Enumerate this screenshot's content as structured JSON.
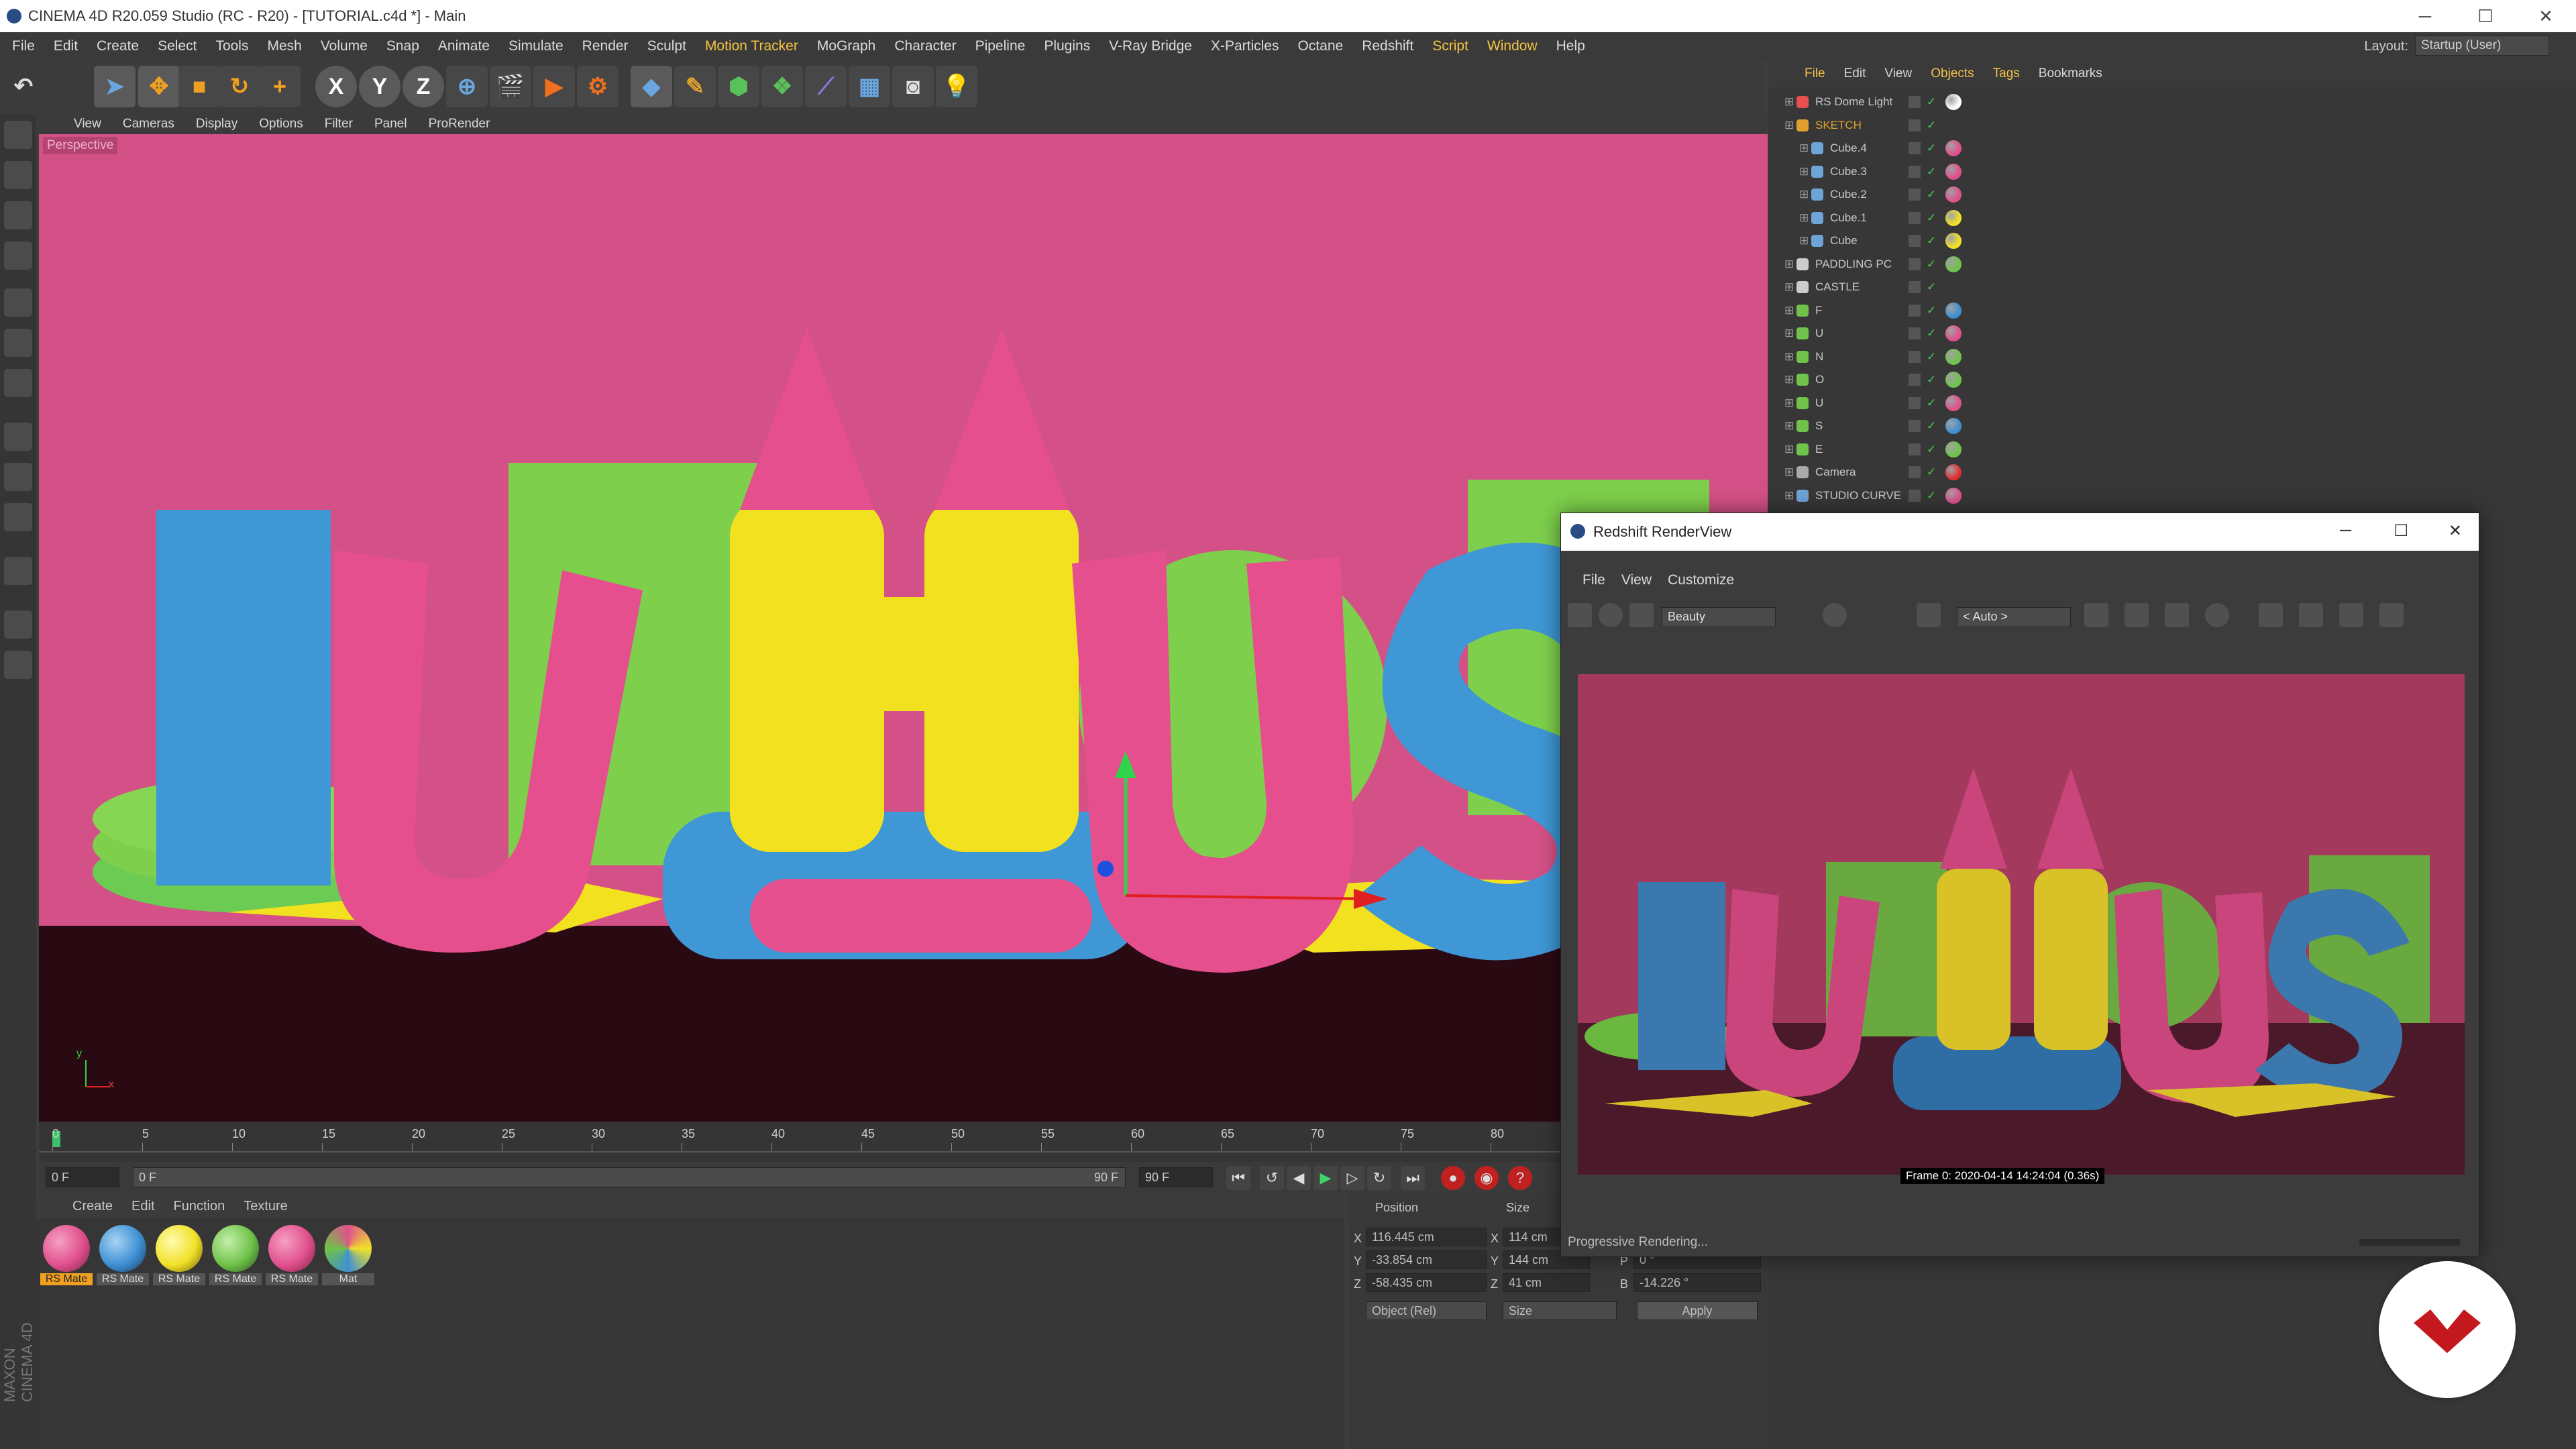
{
  "window": {
    "title": "CINEMA 4D R20.059 Studio (RC - R20) - [TUTORIAL.c4d *] - Main",
    "min_symbol": "─",
    "max_symbol": "☐",
    "close_symbol": "✕"
  },
  "menubar": {
    "items": [
      "File",
      "Edit",
      "Create",
      "Select",
      "Tools",
      "Mesh",
      "Volume",
      "Snap",
      "Animate",
      "Simulate",
      "Render",
      "Sculpt",
      "Motion Tracker",
      "MoGraph",
      "Character",
      "Pipeline",
      "Plugins",
      "V-Ray Bridge",
      "X-Particles",
      "Octane",
      "Redshift",
      "Script",
      "Window",
      "Help"
    ],
    "layout_label": "Layout:",
    "layout_value": "Startup (User)"
  },
  "toolbar": {
    "axis_x": "X",
    "axis_y": "Y",
    "axis_z": "Z"
  },
  "viewport": {
    "menu": [
      "View",
      "Cameras",
      "Display",
      "Options",
      "Filter",
      "Panel",
      "ProRender"
    ],
    "label": "Perspective",
    "axis_y": "y",
    "axis_x": "x",
    "scene_word": "FUNHOUSE",
    "colors": {
      "background": "#d35187",
      "floor": "#2a0a12",
      "blue": "#3f97d6",
      "pink": "#e64f8d",
      "yellow": "#f2e11f",
      "green": "#7ed04c"
    }
  },
  "timeline": {
    "ticks": [
      "0",
      "5",
      "10",
      "15",
      "20",
      "25",
      "30",
      "35",
      "40",
      "45",
      "50",
      "55",
      "60",
      "65",
      "70",
      "75",
      "80"
    ],
    "current_frame": "0 F",
    "range_start": "0 F",
    "range_end": "90 F",
    "end_field": "90 F"
  },
  "materials": {
    "menu": [
      "Create",
      "Edit",
      "Function",
      "Texture"
    ],
    "items": [
      {
        "label": "RS Mate",
        "color": "#e0508d",
        "selected": true
      },
      {
        "label": "RS Mate",
        "color": "#3e90d3",
        "selected": false
      },
      {
        "label": "RS Mate",
        "color": "#f1e128",
        "selected": false
      },
      {
        "label": "RS Mate",
        "color": "#6fc24a",
        "selected": false
      },
      {
        "label": "RS Mate",
        "color": "#e0508d",
        "selected": false
      },
      {
        "label": "Mat",
        "color": "#6b4a2a",
        "selected": false
      }
    ]
  },
  "coordinates": {
    "position_header": "Position",
    "size_header": "Size",
    "rows": [
      {
        "axis": "X",
        "pos": "116.445 cm",
        "size_axis": "X",
        "size": "114 cm"
      },
      {
        "axis": "Y",
        "pos": "-33.854 cm",
        "size_axis": "Y",
        "size": "144 cm"
      },
      {
        "axis": "Z",
        "pos": "-58.435 cm",
        "size_axis": "Z",
        "size": "41 cm"
      }
    ],
    "rot_h_label": "H",
    "rot_h": "",
    "rot_p_label": "P",
    "rot_p": "0 °",
    "rot_b_label": "B",
    "rot_b": "-14.226 °",
    "mode": "Object (Rel)",
    "size_mode": "Size",
    "apply": "Apply"
  },
  "object_manager": {
    "menu": [
      "File",
      "Edit",
      "View",
      "Objects",
      "Tags",
      "Bookmarks"
    ],
    "objects": [
      {
        "name": "RS Dome Light",
        "indent": 0,
        "color": "#e85050",
        "tags": [
          "#ffffff"
        ]
      },
      {
        "name": "SKETCH",
        "indent": 0,
        "color": "#e0a030",
        "tags": []
      },
      {
        "name": "Cube.4",
        "indent": 1,
        "color": "#6fa4d8",
        "tags": [
          "#e0508d"
        ]
      },
      {
        "name": "Cube.3",
        "indent": 1,
        "color": "#6fa4d8",
        "tags": [
          "#e0508d"
        ]
      },
      {
        "name": "Cube.2",
        "indent": 1,
        "color": "#6fa4d8",
        "tags": [
          "#e0508d"
        ]
      },
      {
        "name": "Cube.1",
        "indent": 1,
        "color": "#6fa4d8",
        "tags": [
          "#f1e128"
        ]
      },
      {
        "name": "Cube",
        "indent": 1,
        "color": "#6fa4d8",
        "tags": [
          "#f1e128"
        ]
      },
      {
        "name": "PADDLING PC",
        "indent": 0,
        "color": "#cccccc",
        "tags": [
          "#6fc24a"
        ]
      },
      {
        "name": "CASTLE",
        "indent": 0,
        "color": "#cccccc",
        "tags": []
      },
      {
        "name": "F",
        "indent": 0,
        "color": "#6fc24a",
        "tags": [
          "#3e90d3"
        ]
      },
      {
        "name": "U",
        "indent": 0,
        "color": "#6fc24a",
        "tags": [
          "#e0508d"
        ]
      },
      {
        "name": "N",
        "indent": 0,
        "color": "#6fc24a",
        "tags": [
          "#6fc24a"
        ]
      },
      {
        "name": "O",
        "indent": 0,
        "color": "#6fc24a",
        "tags": [
          "#6fc24a"
        ]
      },
      {
        "name": "U",
        "indent": 0,
        "color": "#6fc24a",
        "tags": [
          "#e0508d"
        ]
      },
      {
        "name": "S",
        "indent": 0,
        "color": "#6fc24a",
        "tags": [
          "#3e90d3"
        ]
      },
      {
        "name": "E",
        "indent": 0,
        "color": "#6fc24a",
        "tags": [
          "#6fc24a"
        ]
      },
      {
        "name": "Camera",
        "indent": 0,
        "color": "#aaaaaa",
        "tags": [
          "#e03030"
        ]
      },
      {
        "name": "STUDIO CURVE",
        "indent": 0,
        "color": "#6fa4d8",
        "tags": [
          "#e0508d"
        ]
      }
    ]
  },
  "render_view": {
    "title": "Redshift RenderView",
    "menu": [
      "File",
      "View",
      "Customize"
    ],
    "aov": "Beauty",
    "camera": "< Auto >",
    "frame_info": "Frame  0:  2020-04-14  14:24:04  (0.36s)",
    "status": "Progressive Rendering...",
    "colors": {
      "background": "#a3395d",
      "floor": "#4a1a2a"
    }
  }
}
